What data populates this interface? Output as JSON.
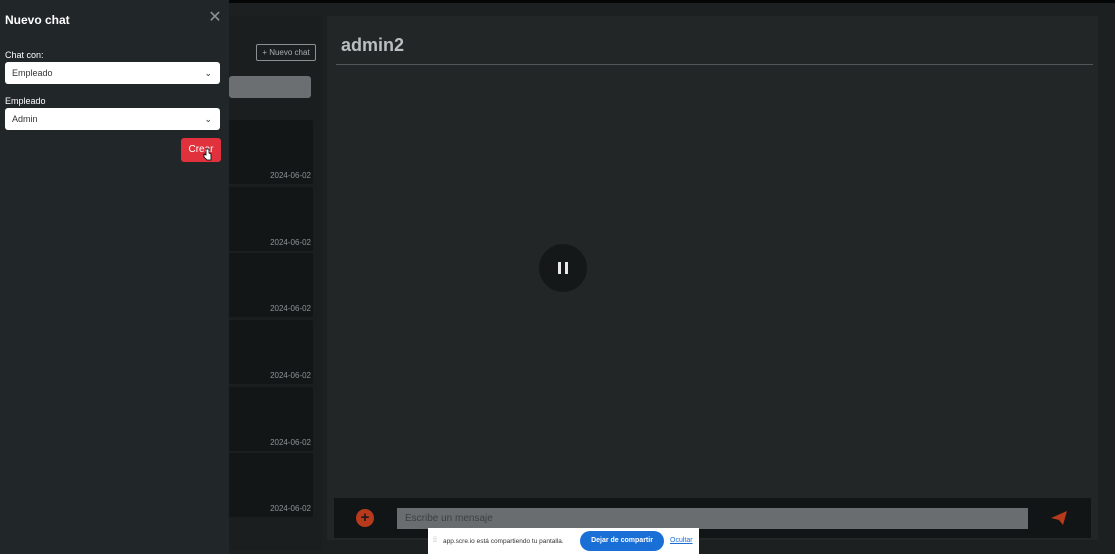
{
  "drawer": {
    "title": "Nuevo chat",
    "close_icon": "close-icon",
    "chat_with_label": "Chat con:",
    "chat_with_value": "Empleado",
    "employee_label": "Empleado",
    "employee_value": "Admin",
    "create_label": "Crear"
  },
  "chat_list": {
    "new_chat_label": "+ Nuevo chat",
    "items": [
      {
        "date": "2024-06-02"
      },
      {
        "date": "2024-06-02"
      },
      {
        "date": "2024-06-02"
      },
      {
        "date": "2024-06-02"
      },
      {
        "date": "2024-06-02"
      },
      {
        "date": "2024-06-02"
      }
    ]
  },
  "conversation": {
    "title": "admin2",
    "input_placeholder": "Escribe un mensaje",
    "add_icon": "plus-circle-icon",
    "send_icon": "paper-plane-icon",
    "pause_icon": "pause-icon"
  },
  "share_bar": {
    "text": "app.scre.io está compartiendo tu pantalla.",
    "stop_label": "Dejar de compartir",
    "hide_label": "Ocultar"
  },
  "colors": {
    "accent_red": "#e0313d",
    "accent_orange": "#b83a1c",
    "share_blue": "#1a6fd6"
  }
}
